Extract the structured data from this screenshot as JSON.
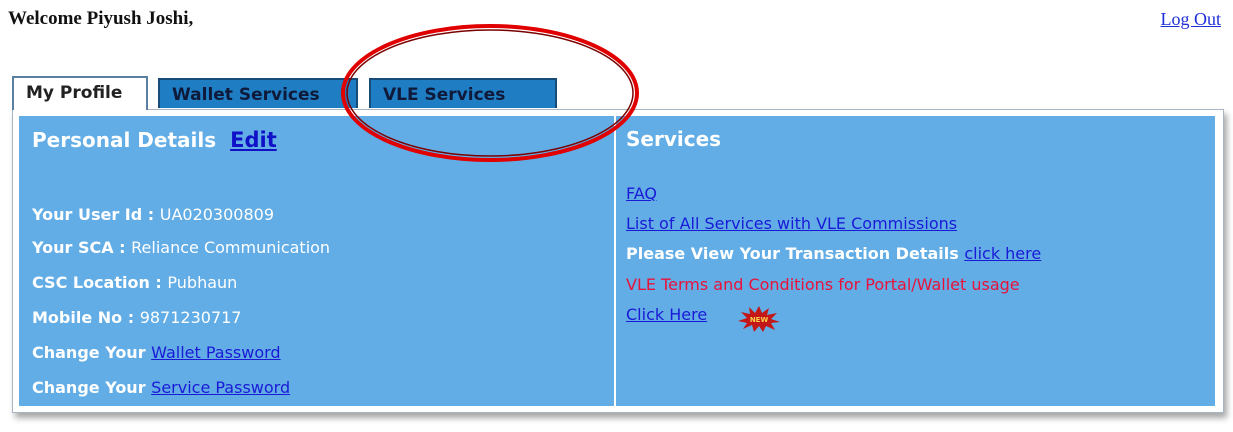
{
  "header": {
    "welcome": "Welcome Piyush Joshi,",
    "logout": "Log Out"
  },
  "tabs": [
    {
      "label": "My Profile",
      "active": true
    },
    {
      "label": "Wallet Services",
      "active": false
    },
    {
      "label": "VLE Services",
      "active": false
    }
  ],
  "personal": {
    "title": "Personal Details",
    "edit": "Edit",
    "user_id_label": "Your User Id : ",
    "user_id": "UA020300809",
    "sca_label": "Your SCA : ",
    "sca": "Reliance Communication",
    "location_label": "CSC Location : ",
    "location": "Pubhaun",
    "mobile_label": "Mobile No : ",
    "mobile": "9871230717",
    "change_label": "Change Your ",
    "wallet_password": "Wallet Password",
    "service_password": "Service Password"
  },
  "services": {
    "title": "Services",
    "faq": "FAQ",
    "commissions": "List of All Services with VLE Commissions",
    "transaction_text": "Please View Your Transaction Details ",
    "transaction_link": "click here",
    "terms": "VLE Terms and Conditions for Portal/Wallet usage",
    "click_here": "Click Here",
    "new_badge": "NEW"
  },
  "colors": {
    "panel_bg": "#62ade6",
    "tab_inactive": "#1f7dc4",
    "link": "#1a1ad6",
    "terms_red": "#e8123a",
    "annotation_red": "#e00000"
  }
}
